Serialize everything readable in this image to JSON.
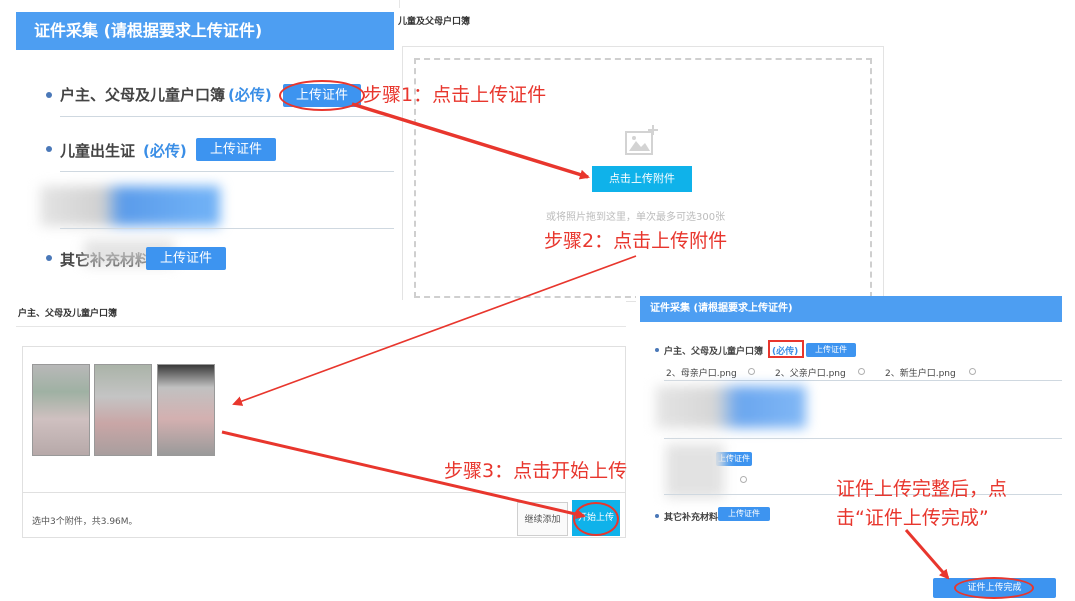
{
  "panel1": {
    "header": "证件采集 (请根据要求上传证件)",
    "row1_label": "户主、父母及儿童户口簿",
    "row1_req": "(必传)",
    "row1_btn": "上传证件",
    "row2_label": "儿童出生证",
    "row2_req": "(必传)",
    "row2_btn": "上传证件",
    "row4_label": "其它补充材料",
    "row4_btn": "上传证件"
  },
  "panel2": {
    "title": "儿童及父母户口簿",
    "upload_btn": "点击上传附件",
    "hint": "或将照片拖到这里，单次最多可选300张"
  },
  "panel3": {
    "title": "户主、父母及儿童户口簿",
    "status": "选中3个附件，共3.96M。",
    "continue_btn": "继续添加",
    "start_btn": "开始上传"
  },
  "panel4": {
    "header": "证件采集 (请根据要求上传证件)",
    "row1_label": "户主、父母及儿童户口簿",
    "row1_req": "(必传)",
    "row1_btn": "上传证件",
    "files": [
      "2、母亲户口.png",
      "2、父亲户口.png",
      "2、新生户口.png"
    ],
    "row3_btn": "上传证件",
    "row4_label": "其它补充材料",
    "row4_btn": "上传证件",
    "complete_btn": "证件上传完成"
  },
  "steps": {
    "step1": "步骤1：点击上传证件",
    "step2": "步骤2：点击上传附件",
    "step3": "步骤3：点击开始上传",
    "step4_line1": "证件上传完整后，点",
    "step4_line2": "击“证件上传完成”"
  },
  "colors": {
    "accent": "#4d9ef2",
    "annotation": "#e8362d",
    "cyan": "#0fb2ea"
  }
}
